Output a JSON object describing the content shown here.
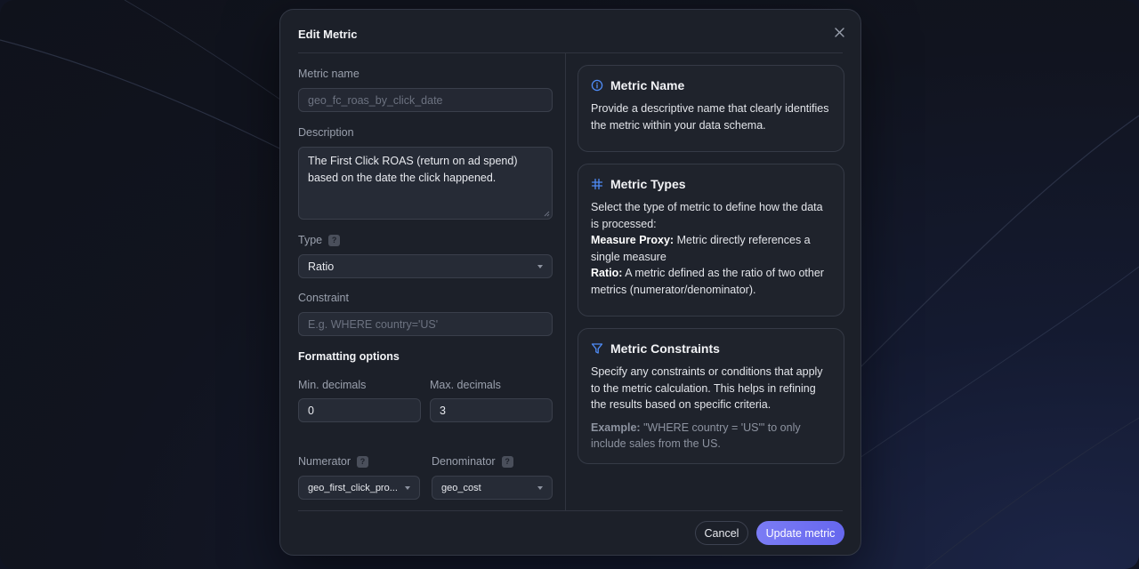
{
  "dialog": {
    "title": "Edit Metric"
  },
  "form": {
    "metric_name_label": "Metric name",
    "metric_name_value": "geo_fc_roas_by_click_date",
    "description_label": "Description",
    "description_line1": "The First Click ROAS (return on ad spend)",
    "description_line2": "based on the date the click happened.",
    "type_label": "Type",
    "type_value": "Ratio",
    "constraint_label": "Constraint",
    "constraint_placeholder": "E.g. WHERE country='US'",
    "formatting_label": "Formatting options",
    "min_decimals_label": "Min. decimals",
    "min_decimals_value": "0",
    "max_decimals_label": "Max. decimals",
    "max_decimals_value": "3",
    "numerator_label": "Numerator",
    "numerator_value": "geo_first_click_pro...",
    "denominator_label": "Denominator",
    "denominator_value": "geo_cost",
    "help_glyph": "?"
  },
  "help_cards": {
    "name": {
      "icon": "info-icon",
      "title": "Metric Name",
      "line1": "Provide a descriptive name that clearly identifies",
      "line2": "the metric within your data schema."
    },
    "types": {
      "icon": "grid-icon",
      "title": "Metric Types",
      "line1": "Select the type of metric to define how the data",
      "line2": "is processed:",
      "measure_term": "Measure Proxy:",
      "measure_desc1": " Metric directly references a",
      "measure_desc2": "single measure",
      "ratio_term": "Ratio:",
      "ratio_desc1": " A metric defined as the ratio of two other",
      "ratio_desc2": "metrics (numerator/denominator)."
    },
    "constraints": {
      "icon": "filter-icon",
      "title": "Metric Constraints",
      "line1": "Specify any constraints or conditions that apply",
      "line2": "to the metric calculation. This helps in refining",
      "line3": "the results based on specific criteria.",
      "example_term": "Example:",
      "example_desc1": " \"WHERE country = 'US'\" to only",
      "example_desc2": "include sales from the US."
    }
  },
  "footer": {
    "cancel_label": "Cancel",
    "update_label": "Update metric"
  },
  "colors": {
    "accent": "#6f70f2",
    "icon_blue": "#3b82f6"
  }
}
